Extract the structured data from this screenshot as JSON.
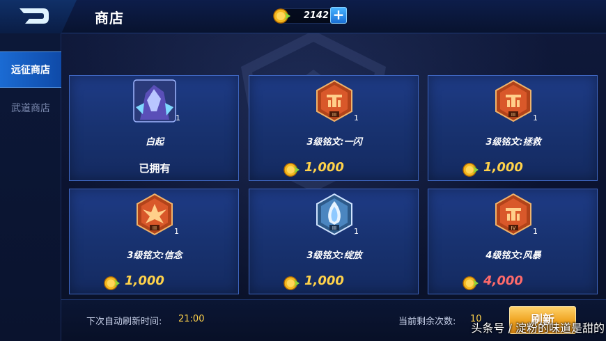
{
  "header": {
    "title": "商店",
    "coin_amount": "2142",
    "plus_label": "+"
  },
  "sidebar": {
    "items": [
      {
        "label": "远征商店",
        "active": true
      },
      {
        "label": "武道商店",
        "active": false
      }
    ]
  },
  "shop": {
    "items": [
      {
        "name": "白起",
        "quantity": "1",
        "status": "已拥有",
        "icon": "hero-portrait-icon"
      },
      {
        "name": "3级铭文:一闪",
        "quantity": "1",
        "price": "1,000",
        "icon": "red-inscription-iii-icon"
      },
      {
        "name": "3级铭文:拯救",
        "quantity": "1",
        "price": "1,000",
        "icon": "red-inscription-iii-icon"
      },
      {
        "name": "3级铭文:信念",
        "quantity": "1",
        "price": "1,000",
        "icon": "red-flower-inscription-iii-icon"
      },
      {
        "name": "3级铭文:绽放",
        "quantity": "1",
        "price": "1,000",
        "icon": "blue-inscription-iii-icon"
      },
      {
        "name": "4级铭文:风暴",
        "quantity": "1",
        "price": "4,000",
        "icon": "red-inscription-iv-icon",
        "price_color": "#ff6a6a"
      }
    ],
    "roman": {
      "iii": "III",
      "iv": "IV"
    }
  },
  "footer": {
    "refresh_time_label": "下次自动刷新时间:",
    "refresh_time": "21:00",
    "remaining_label": "当前剩余次数:",
    "remaining_count": "10",
    "refresh_button": "刷新"
  },
  "watermark": "头条号 / 淀粉的味道是甜的",
  "colors": {
    "accent": "#1b6bd3",
    "price": "#ffd24a",
    "price_warning": "#ff6a6a",
    "button": "#f0a625"
  }
}
